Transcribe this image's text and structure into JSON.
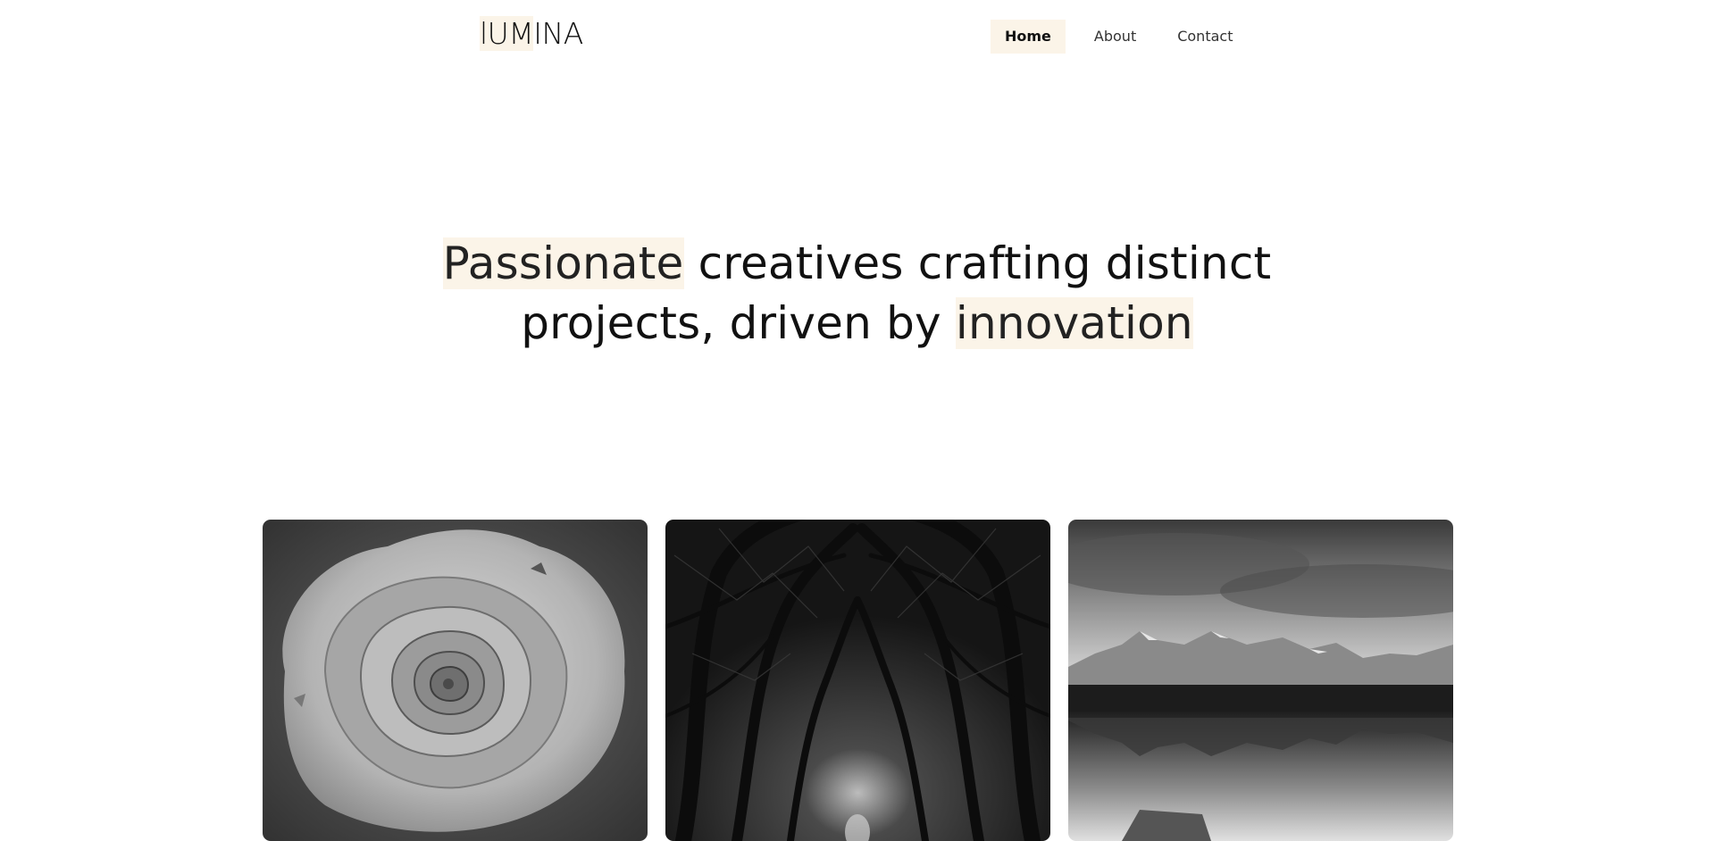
{
  "header": {
    "logo": {
      "highlight": "lUM",
      "rest": "INA"
    },
    "nav": [
      {
        "label": "Home",
        "active": true
      },
      {
        "label": "About",
        "active": false
      },
      {
        "label": "Contact",
        "active": false
      }
    ]
  },
  "hero": {
    "line1": {
      "highlight": "Passionate",
      "rest": " creatives crafting distinct"
    },
    "line2": {
      "plain": "projects, driven by ",
      "highlight": "innovation"
    }
  },
  "gallery": {
    "items": [
      {
        "subject": "rose-photo"
      },
      {
        "subject": "tree-tunnel-photo"
      },
      {
        "subject": "mountain-lake-photo"
      }
    ]
  },
  "colors": {
    "highlight_bg": "#fbf4e8",
    "text": "#111111",
    "background": "#ffffff"
  }
}
